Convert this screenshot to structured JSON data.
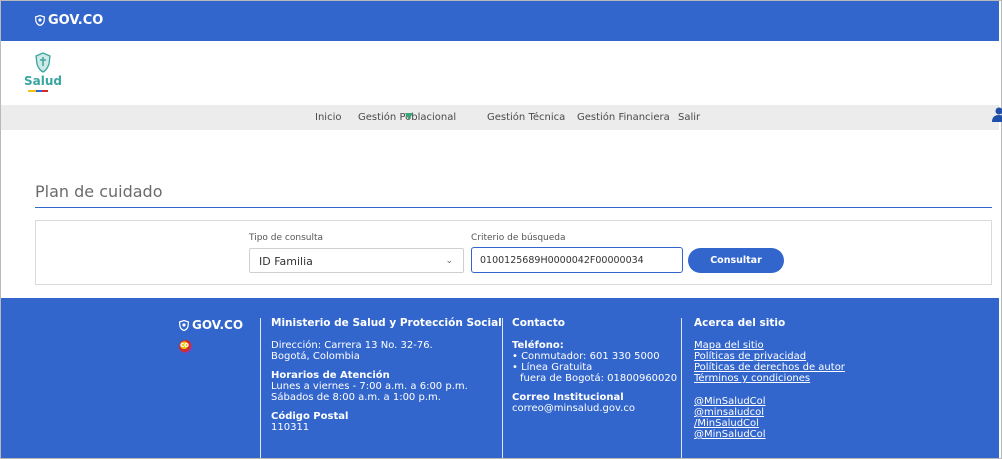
{
  "topbar": {
    "brand": "GOV.CO"
  },
  "logo": {
    "text": "Salud"
  },
  "nav": {
    "items": [
      "Inicio",
      "Gestión Poblacional",
      "Gestión Técnica",
      "Gestión Financiera",
      "Salir"
    ]
  },
  "page": {
    "title": "Plan de cuidado"
  },
  "search": {
    "tipo_label": "Tipo de consulta",
    "tipo_value": "ID Familia",
    "criterio_label": "Criterio de búsqueda",
    "criterio_value": "0100125689H0000042F00000034",
    "button_label": "Consultar"
  },
  "footer": {
    "brand": "GOV.CO",
    "co_badge": "co",
    "ministerio": {
      "title": "Ministerio de Salud y Protección Social",
      "direccion_1": "Dirección: Carrera 13 No. 32-76.",
      "direccion_2": "Bogotá, Colombia",
      "horarios_title": "Horarios de Atención",
      "horario_1": "Lunes a viernes - 7:00 a.m. a 6:00 p.m.",
      "horario_2": "Sábados de 8:00 a.m. a 1:00 p.m.",
      "postal_title": "Código Postal",
      "postal_value": "110311"
    },
    "contacto": {
      "title": "Contacto",
      "telefono_title": "Teléfono:",
      "conmutador": "• Conmutador: 601 330 5000",
      "linea_1": "• Línea Gratuita",
      "linea_2": "fuera de Bogotá: 01800960020",
      "correo_title": "Correo Institucional",
      "correo_value": "correo@minsalud.gov.co"
    },
    "acerca": {
      "title": "Acerca del sitio",
      "links": [
        "Mapa del sitio",
        "Políticas de privacidad",
        "Políticas de derechos de autor",
        "Términos y condiciones"
      ],
      "social": [
        "@MinSaludCol",
        "@minsaludcol",
        "/MinSaludCol",
        "@MinSaludCol"
      ]
    }
  },
  "colors": {
    "brand_blue": "#3366cc",
    "accent_green": "#3aa57a",
    "logo_teal": "#3aa6a0"
  }
}
